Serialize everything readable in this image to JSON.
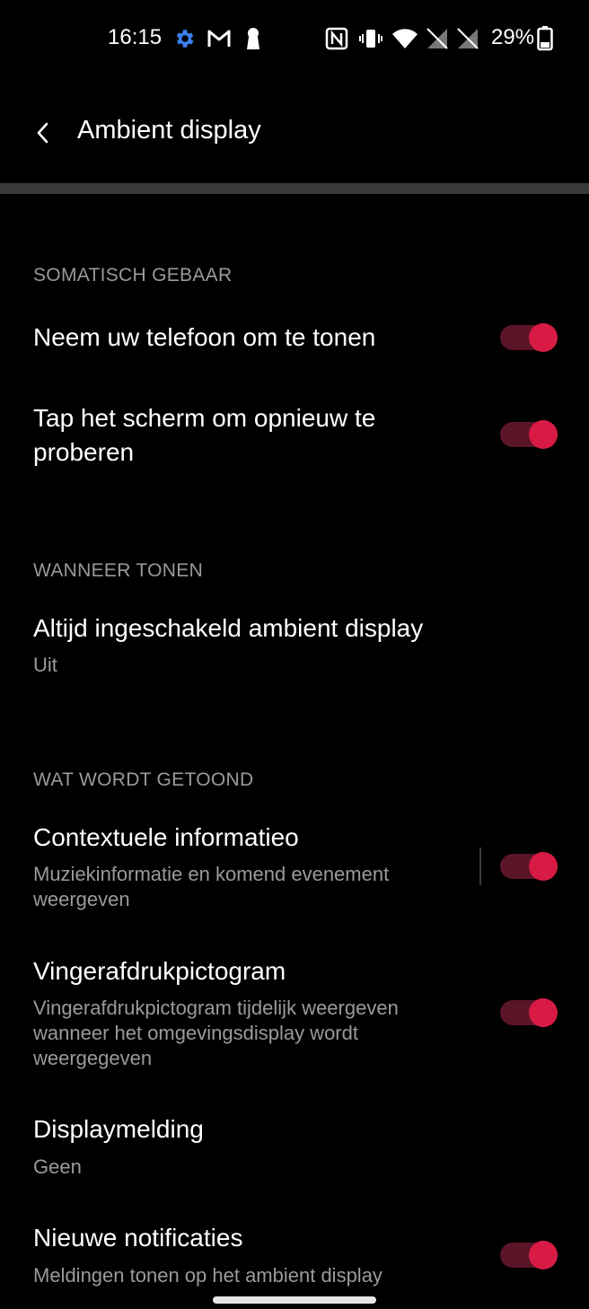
{
  "status": {
    "time": "16:15",
    "battery": "29%",
    "icons": [
      "gear-icon",
      "gmail-icon",
      "keyhole-icon",
      "nfc-icon",
      "vibrate-icon",
      "wifi-icon",
      "no-sim-icon",
      "no-sim-icon",
      "battery-icon"
    ]
  },
  "appbar": {
    "title": "Ambient display"
  },
  "sections": {
    "gesture": {
      "header": "SOMATISCH GEBAAR"
    },
    "when": {
      "header": "WANNEER TONEN"
    },
    "what": {
      "header": "WAT WORDT GETOOND"
    }
  },
  "settings": {
    "pickup": {
      "title": "Neem uw telefoon om te tonen",
      "enabled": true
    },
    "tap": {
      "title": "Tap het scherm om opnieuw te proberen",
      "enabled": true
    },
    "always_on": {
      "title": "Altijd ingeschakeld ambient display",
      "value": "Uit"
    },
    "contextual": {
      "title": "Contextuele informatieo",
      "subtitle": "Muziekinformatie en komend evenement weergeven",
      "enabled": true
    },
    "fingerprint": {
      "title": "Vingerafdrukpictogram",
      "subtitle": "Vingerafdrukpictogram tijdelijk weergeven wanneer het omgevingsdisplay wordt weergegeven",
      "enabled": true
    },
    "display_notif": {
      "title": "Displaymelding",
      "value": "Geen"
    },
    "new_notif": {
      "title": "Nieuwe notificaties",
      "subtitle": "Meldingen tonen op het ambient display",
      "enabled": true
    }
  },
  "colors": {
    "accent": "#d81b45",
    "track": "#5a1528",
    "background": "#000000",
    "secondary_text": "#9a9a9a"
  }
}
